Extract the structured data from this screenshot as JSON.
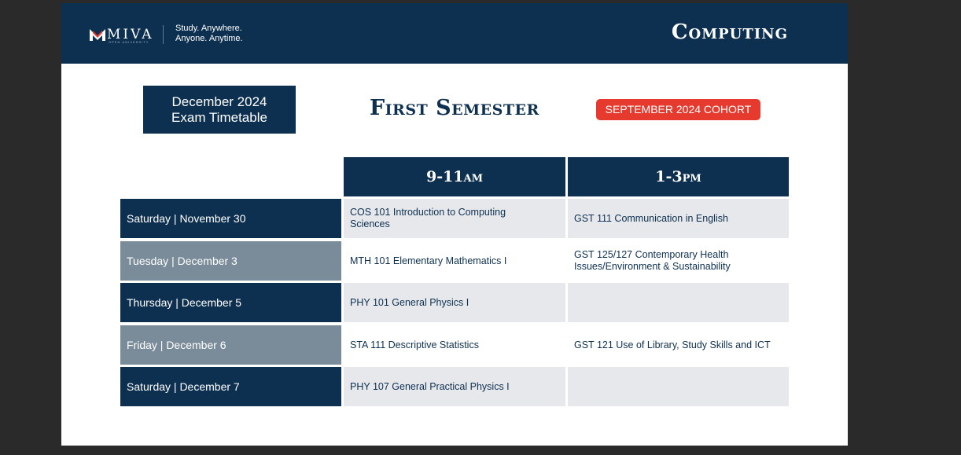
{
  "colors": {
    "navy": "#0e3050",
    "grey": "#7a8c99",
    "red": "#e63a2e",
    "light": "#e6e8ec"
  },
  "header": {
    "logo_text": "MIVA",
    "logo_subtext": "OPEN UNIVERSITY",
    "tagline_1": "Study. Anywhere.",
    "tagline_2": "Anyone. Anytime.",
    "title": "Computing"
  },
  "exam_box": {
    "line1": "December 2024",
    "line2": "Exam Timetable"
  },
  "semester": "First Semester",
  "cohort": "SEPTEMBER 2024 COHORT",
  "columns": {
    "am": "9-11am",
    "pm": "1-3pm"
  },
  "rows": [
    {
      "day": "Saturday | November 30",
      "am": "COS 101 Introduction to Computing Sciences",
      "pm": "GST 111 Communication in English"
    },
    {
      "day": "Tuesday | December 3",
      "am": "MTH 101 Elementary Mathematics I",
      "pm": "GST 125/127  Contemporary Health Issues/Environment & Sustainability"
    },
    {
      "day": "Thursday | December 5",
      "am": "PHY 101 General Physics I",
      "pm": ""
    },
    {
      "day": "Friday | December 6",
      "am": "STA 111 Descriptive Statistics",
      "pm": "GST 121 Use of Library, Study Skills and ICT"
    },
    {
      "day": "Saturday | December 7",
      "am": "PHY 107 General Practical Physics I",
      "pm": ""
    }
  ]
}
